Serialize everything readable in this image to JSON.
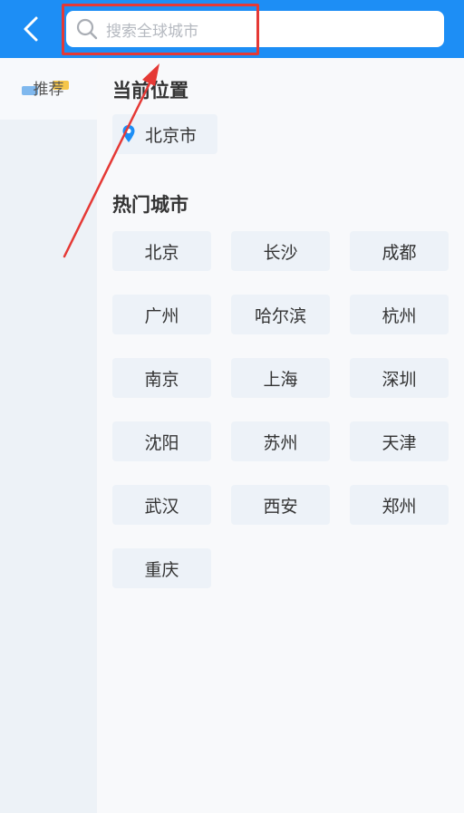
{
  "header": {
    "back_icon": "chevron-left-icon",
    "search": {
      "icon": "search-icon",
      "placeholder": "搜索全球城市"
    }
  },
  "sidebar": {
    "items": [
      {
        "label": "推荐",
        "selected": true
      }
    ]
  },
  "main": {
    "current_location": {
      "title": "当前位置",
      "city": "北京市",
      "icon": "location-pin-icon"
    },
    "hot_cities": {
      "title": "热门城市",
      "cities": [
        "北京",
        "长沙",
        "成都",
        "广州",
        "哈尔滨",
        "杭州",
        "南京",
        "上海",
        "深圳",
        "沈阳",
        "苏州",
        "天津",
        "武汉",
        "西安",
        "郑州",
        "重庆"
      ]
    }
  },
  "colors": {
    "header_bg": "#1d8ef5",
    "annotation_red": "#e53935",
    "chip_bg": "#edf2f8",
    "pin_blue": "#1d8ef5"
  }
}
